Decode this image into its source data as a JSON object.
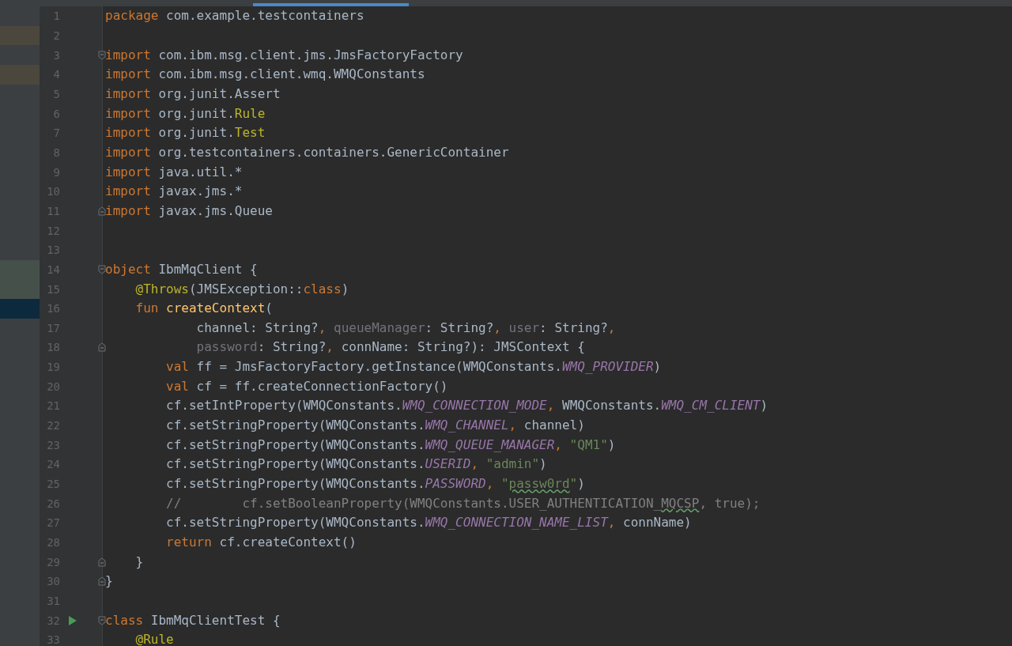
{
  "editor": {
    "lines": [
      {
        "number": "1",
        "tokens": [
          {
            "text": "package",
            "kind": "keyword"
          },
          {
            "text": " com.example.testcontainers",
            "kind": "plain"
          }
        ]
      },
      {
        "number": "2",
        "gutter_mark": {
          "color": "#4b473d"
        }
      },
      {
        "number": "3",
        "fold_marker": {
          "kind": "start"
        },
        "tokens": [
          {
            "text": "import",
            "kind": "keyword"
          },
          {
            "text": " com.ibm.msg.client.jms.JmsFactoryFactory",
            "kind": "plain"
          }
        ]
      },
      {
        "number": "4",
        "gutter_mark": {
          "color": "#4b473d"
        },
        "tokens": [
          {
            "text": "import",
            "kind": "keyword"
          },
          {
            "text": " com.ibm.msg.client.wmq.WMQConstants",
            "kind": "plain"
          }
        ]
      },
      {
        "number": "5",
        "tokens": [
          {
            "text": "import",
            "kind": "keyword"
          },
          {
            "text": " org.junit.Assert",
            "kind": "plain"
          }
        ]
      },
      {
        "number": "6",
        "tokens": [
          {
            "text": "import",
            "kind": "keyword"
          },
          {
            "text": " org.junit.",
            "kind": "plain"
          },
          {
            "text": "Rule",
            "kind": "annotation"
          }
        ]
      },
      {
        "number": "7",
        "tokens": [
          {
            "text": "import",
            "kind": "keyword"
          },
          {
            "text": " org.junit.",
            "kind": "plain"
          },
          {
            "text": "Test",
            "kind": "annotation"
          }
        ]
      },
      {
        "number": "8",
        "tokens": [
          {
            "text": "import",
            "kind": "keyword"
          },
          {
            "text": " org.testcontainers.containers.GenericContainer",
            "kind": "plain"
          }
        ]
      },
      {
        "number": "9",
        "tokens": [
          {
            "text": "import",
            "kind": "keyword"
          },
          {
            "text": " java.util.*",
            "kind": "plain"
          }
        ]
      },
      {
        "number": "10",
        "tokens": [
          {
            "text": "import",
            "kind": "keyword"
          },
          {
            "text": " javax.jms.*",
            "kind": "plain"
          }
        ]
      },
      {
        "number": "11",
        "fold_marker": {
          "kind": "end"
        },
        "tokens": [
          {
            "text": "import",
            "kind": "keyword"
          },
          {
            "text": " javax.jms.Queue",
            "kind": "plain"
          }
        ]
      },
      {
        "number": "12"
      },
      {
        "number": "13"
      },
      {
        "number": "14",
        "gutter_mark": {
          "color": "#45504a"
        },
        "fold_marker": {
          "kind": "start"
        },
        "tokens": [
          {
            "text": "object",
            "kind": "keyword"
          },
          {
            "text": " IbmMqClient {",
            "kind": "plain"
          }
        ]
      },
      {
        "number": "15",
        "gutter_mark": {
          "color": "#45504a"
        },
        "tokens": [
          {
            "text": "    @Throws",
            "kind": "annotation"
          },
          {
            "text": "(JMSException::",
            "kind": "plain"
          },
          {
            "text": "class",
            "kind": "keyword"
          },
          {
            "text": ")",
            "kind": "plain"
          }
        ]
      },
      {
        "number": "16",
        "gutter_mark": {
          "color": "#0d293e"
        },
        "tokens": [
          {
            "text": "    fun",
            "kind": "keyword"
          },
          {
            "text": " createContext",
            "kind": "function"
          },
          {
            "text": "(",
            "kind": "plain"
          }
        ]
      },
      {
        "number": "17",
        "tokens": [
          {
            "text": "            channel: String?",
            "kind": "plain"
          },
          {
            "text": ",",
            "kind": "keyword"
          },
          {
            "text": " queueManager",
            "kind": "unused"
          },
          {
            "text": ": String?",
            "kind": "plain"
          },
          {
            "text": ",",
            "kind": "keyword"
          },
          {
            "text": " user",
            "kind": "unused"
          },
          {
            "text": ": String?",
            "kind": "plain"
          },
          {
            "text": ",",
            "kind": "keyword"
          }
        ]
      },
      {
        "number": "18",
        "fold_marker": {
          "kind": "end"
        },
        "tokens": [
          {
            "text": "            password",
            "kind": "unused"
          },
          {
            "text": ": String?",
            "kind": "plain"
          },
          {
            "text": ",",
            "kind": "keyword"
          },
          {
            "text": " connName: String?): JMSContext {",
            "kind": "plain"
          }
        ]
      },
      {
        "number": "19",
        "tokens": [
          {
            "text": "        val",
            "kind": "keyword"
          },
          {
            "text": " ff = JmsFactoryFactory.getInstance(WMQConstants.",
            "kind": "plain"
          },
          {
            "text": "WMQ_PROVIDER",
            "kind": "constant"
          },
          {
            "text": ")",
            "kind": "plain"
          }
        ]
      },
      {
        "number": "20",
        "tokens": [
          {
            "text": "        val",
            "kind": "keyword"
          },
          {
            "text": " cf = ff.createConnectionFactory()",
            "kind": "plain"
          }
        ]
      },
      {
        "number": "21",
        "tokens": [
          {
            "text": "        cf.setIntProperty(WMQConstants.",
            "kind": "plain"
          },
          {
            "text": "WMQ_CONNECTION_MODE",
            "kind": "constant"
          },
          {
            "text": ",",
            "kind": "keyword"
          },
          {
            "text": " WMQConstants.",
            "kind": "plain"
          },
          {
            "text": "WMQ_CM_CLIENT",
            "kind": "constant"
          },
          {
            "text": ")",
            "kind": "plain"
          }
        ]
      },
      {
        "number": "22",
        "tokens": [
          {
            "text": "        cf.setStringProperty(WMQConstants.",
            "kind": "plain"
          },
          {
            "text": "WMQ_CHANNEL",
            "kind": "constant"
          },
          {
            "text": ",",
            "kind": "keyword"
          },
          {
            "text": " channel)",
            "kind": "plain"
          }
        ]
      },
      {
        "number": "23",
        "tokens": [
          {
            "text": "        cf.setStringProperty(WMQConstants.",
            "kind": "plain"
          },
          {
            "text": "WMQ_QUEUE_MANAGER",
            "kind": "constant"
          },
          {
            "text": ",",
            "kind": "keyword"
          },
          {
            "text": " \"QM1\"",
            "kind": "string"
          },
          {
            "text": ")",
            "kind": "plain"
          }
        ]
      },
      {
        "number": "24",
        "tokens": [
          {
            "text": "        cf.setStringProperty(WMQConstants.",
            "kind": "plain"
          },
          {
            "text": "USERID",
            "kind": "constant"
          },
          {
            "text": ",",
            "kind": "keyword"
          },
          {
            "text": " \"admin\"",
            "kind": "string"
          },
          {
            "text": ")",
            "kind": "plain"
          }
        ]
      },
      {
        "number": "25",
        "tokens": [
          {
            "text": "        cf.setStringProperty(WMQConstants.",
            "kind": "plain"
          },
          {
            "text": "PASSWORD",
            "kind": "constant"
          },
          {
            "text": ",",
            "kind": "keyword"
          },
          {
            "text": " \"",
            "kind": "string"
          },
          {
            "text": "passw0rd",
            "kind": "stringtypo"
          },
          {
            "text": "\"",
            "kind": "string"
          },
          {
            "text": ")",
            "kind": "plain"
          }
        ]
      },
      {
        "number": "26",
        "tokens": [
          {
            "text": "        //        cf.setBooleanProperty(WMQConstants.USER_AUTHENTICATION_",
            "kind": "comment"
          },
          {
            "text": "MQCSP",
            "kind": "commenttypo"
          },
          {
            "text": ", true);",
            "kind": "comment"
          }
        ]
      },
      {
        "number": "27",
        "tokens": [
          {
            "text": "        cf.setStringProperty(WMQConstants.",
            "kind": "plain"
          },
          {
            "text": "WMQ_CONNECTION_NAME_LIST",
            "kind": "constant"
          },
          {
            "text": ",",
            "kind": "keyword"
          },
          {
            "text": " connName)",
            "kind": "plain"
          }
        ]
      },
      {
        "number": "28",
        "tokens": [
          {
            "text": "        return",
            "kind": "keyword"
          },
          {
            "text": " cf.createContext()",
            "kind": "plain"
          }
        ]
      },
      {
        "number": "29",
        "fold_marker": {
          "kind": "end"
        },
        "tokens": [
          {
            "text": "    }",
            "kind": "plain"
          }
        ]
      },
      {
        "number": "30",
        "fold_marker": {
          "kind": "end"
        },
        "tokens": [
          {
            "text": "}",
            "kind": "plain"
          }
        ]
      },
      {
        "number": "31"
      },
      {
        "number": "32",
        "fold_marker": {
          "kind": "start"
        },
        "run": true,
        "tokens": [
          {
            "text": "class",
            "kind": "keyword"
          },
          {
            "text": " IbmMqClientTest {",
            "kind": "plain"
          }
        ]
      },
      {
        "number": "33",
        "tokens": [
          {
            "text": "    @Rule",
            "kind": "annotation"
          }
        ]
      }
    ]
  }
}
